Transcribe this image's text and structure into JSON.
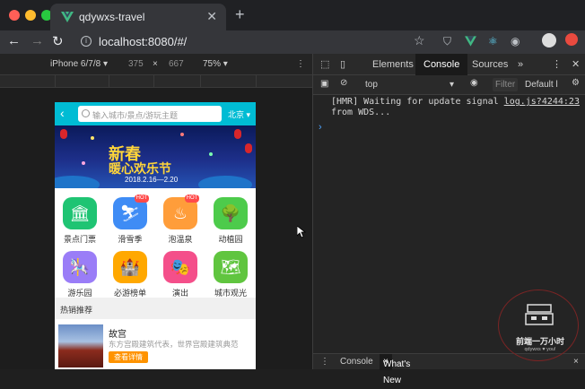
{
  "browser": {
    "tab_title": "qdywxs-travel",
    "url": "localhost:8080/#/",
    "new_tab": "+",
    "close_tab": "✕"
  },
  "device_toolbar": {
    "device": "iPhone 6/7/8",
    "width": "375",
    "times": "×",
    "height": "667",
    "zoom": "75%",
    "menu": "⋮"
  },
  "app": {
    "search_placeholder": "输入城市/景点/游玩主题",
    "city": "北京",
    "banner": {
      "line1": "新春",
      "line2": "暖心欢乐节",
      "date": "2018.2.16—2.20"
    },
    "icons": [
      {
        "label": "景点门票",
        "color": "#1fc473",
        "glyph": "🏛",
        "hot": false
      },
      {
        "label": "滑雪季",
        "color": "#3f8cf5",
        "glyph": "⛷",
        "hot": true
      },
      {
        "label": "泡温泉",
        "color": "#ff9d3a",
        "glyph": "♨",
        "hot": true
      },
      {
        "label": "动植园",
        "color": "#4dcb4b",
        "glyph": "🌳",
        "hot": false
      },
      {
        "label": "游乐园",
        "color": "#9a7df7",
        "glyph": "🎠",
        "hot": false
      },
      {
        "label": "必游榜单",
        "color": "#ffa800",
        "glyph": "🏰",
        "hot": false
      },
      {
        "label": "演出",
        "color": "#f44f8a",
        "glyph": "🎭",
        "hot": false
      },
      {
        "label": "城市观光",
        "color": "#60c53f",
        "glyph": "🗺",
        "hot": false
      }
    ],
    "hot_badge": "HOT",
    "section_title": "热销推荐",
    "item": {
      "name": "故宫",
      "desc": "东方宫殿建筑代表，世界宫殿建筑典范",
      "button": "查看详情"
    }
  },
  "devtools": {
    "tabs": [
      "Elements",
      "Console",
      "Sources"
    ],
    "active_tab": "Console",
    "more": "»",
    "context": "top",
    "filter_placeholder": "Filter",
    "levels": "Default l",
    "message_text": "[HMR] Waiting for update signal",
    "message_link": "log.js?4244:23",
    "message_line2": "from WDS...",
    "prompt": "›",
    "drawer_tabs": [
      "Console",
      "What's New"
    ],
    "drawer_close": "×"
  },
  "watermark": {
    "line1": "前端一万小时",
    "line2": "qdywxs ♥ you!"
  }
}
